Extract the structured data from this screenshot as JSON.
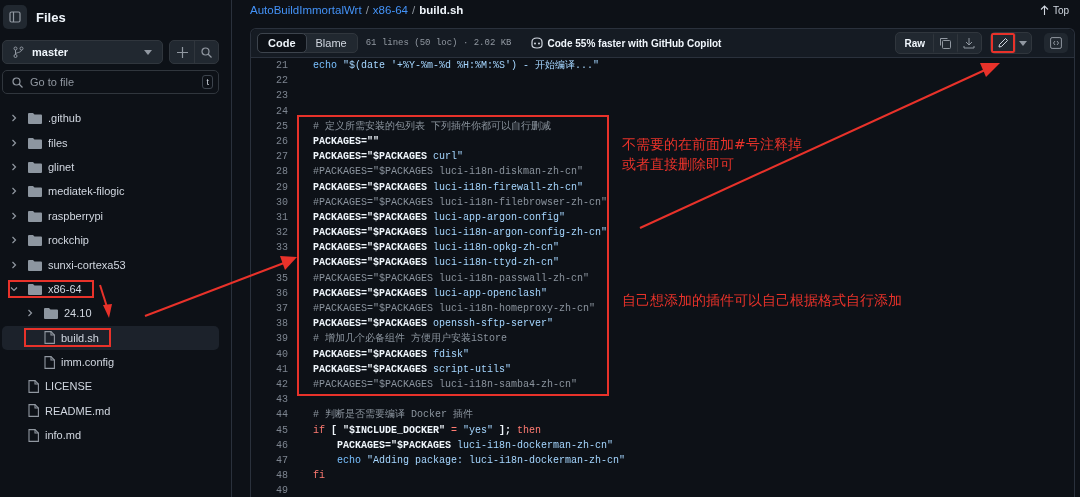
{
  "sidebar": {
    "title": "Files",
    "branch": "master",
    "search": {
      "placeholder": "Go to file",
      "shortcut": "t"
    },
    "tree": [
      {
        "name": ".github",
        "kind": "folder",
        "expanded": false,
        "selected": false,
        "marked": false
      },
      {
        "name": "files",
        "kind": "folder",
        "expanded": false,
        "selected": false,
        "marked": false
      },
      {
        "name": "glinet",
        "kind": "folder",
        "expanded": false,
        "selected": false,
        "marked": false
      },
      {
        "name": "mediatek-filogic",
        "kind": "folder",
        "expanded": false,
        "selected": false,
        "marked": false
      },
      {
        "name": "raspberrypi",
        "kind": "folder",
        "expanded": false,
        "selected": false,
        "marked": false
      },
      {
        "name": "rockchip",
        "kind": "folder",
        "expanded": false,
        "selected": false,
        "marked": false
      },
      {
        "name": "sunxi-cortexa53",
        "kind": "folder",
        "expanded": false,
        "selected": false,
        "marked": false
      },
      {
        "name": "x86-64",
        "kind": "folder",
        "expanded": true,
        "selected": false,
        "marked": true,
        "children": [
          {
            "name": "24.10",
            "kind": "folder",
            "expanded": false,
            "selected": false,
            "marked": false
          },
          {
            "name": "build.sh",
            "kind": "file",
            "selected": true,
            "marked": true
          },
          {
            "name": "imm.config",
            "kind": "file",
            "selected": false,
            "marked": false
          }
        ]
      },
      {
        "name": "LICENSE",
        "kind": "file",
        "selected": false,
        "marked": false
      },
      {
        "name": "README.md",
        "kind": "file",
        "selected": false,
        "marked": false
      },
      {
        "name": "info.md",
        "kind": "file",
        "selected": false,
        "marked": false
      }
    ]
  },
  "breadcrumb": [
    "AutoBuildImmortalWrt",
    "x86-64",
    "build.sh"
  ],
  "breadcrumb_separator": "/",
  "top_link": "Top",
  "toolbar": {
    "tabs": [
      {
        "label": "Code",
        "selected": true
      },
      {
        "label": "Blame",
        "selected": false
      }
    ],
    "file_info": "61 lines (50 loc) · 2.02 KB",
    "copilot": "Code 55% faster with GitHub Copilot",
    "raw": "Raw",
    "edit_marked": true
  },
  "code_blocks": [
    {
      "marked": false,
      "lines": [
        {
          "num": "21",
          "parts": [
            {
              "t": "echo",
              "kind": "kw"
            },
            {
              "t": " \"$(date '+%Y-%m-%d %H:%M:%S') - 开始编译...\"",
              "kind": "str"
            }
          ]
        },
        {
          "num": "22"
        },
        {
          "num": "23"
        },
        {
          "num": "24"
        }
      ]
    },
    {
      "marked": true,
      "lines": [
        {
          "num": "25",
          "parts": [
            {
              "t": "# 定义所需安装的包列表 下列插件你都可以自行删减",
              "kind": "cmt"
            }
          ]
        },
        {
          "num": "26",
          "parts": [
            {
              "t": "PACKAGES=\"\"",
              "kind": "text"
            }
          ]
        },
        {
          "num": "27",
          "parts": [
            {
              "t": "PACKAGES=\"$PACKAGES",
              "kind": "text"
            },
            {
              "t": " curl\"",
              "kind": "str"
            }
          ]
        },
        {
          "num": "28",
          "parts": [
            {
              "t": "#PACKAGES=\"$PACKAGES luci-i18n-diskman-zh-cn\"",
              "kind": "cmt"
            }
          ]
        },
        {
          "num": "29",
          "parts": [
            {
              "t": "PACKAGES=\"$PACKAGES",
              "kind": "text"
            },
            {
              "t": " luci-i18n-firewall-zh-cn\"",
              "kind": "str"
            }
          ]
        },
        {
          "num": "30",
          "parts": [
            {
              "t": "#PACKAGES=\"$PACKAGES luci-i18n-filebrowser-zh-cn\"",
              "kind": "cmt"
            }
          ]
        },
        {
          "num": "31",
          "parts": [
            {
              "t": "PACKAGES=\"$PACKAGES",
              "kind": "text"
            },
            {
              "t": " luci-app-argon-config\"",
              "kind": "str"
            }
          ]
        },
        {
          "num": "32",
          "parts": [
            {
              "t": "PACKAGES=\"$PACKAGES",
              "kind": "text"
            },
            {
              "t": " luci-i18n-argon-config-zh-cn\"",
              "kind": "str"
            }
          ]
        },
        {
          "num": "33",
          "parts": [
            {
              "t": "PACKAGES=\"$PACKAGES",
              "kind": "text"
            },
            {
              "t": " luci-i18n-opkg-zh-cn\"",
              "kind": "str"
            }
          ]
        },
        {
          "parts": [
            {
              "t": "PACKAGES=\"$PACKAGES",
              "kind": "text"
            },
            {
              "t": " luci-i18n-ttyd-zh-cn\"",
              "kind": "str"
            }
          ]
        },
        {
          "num": "35",
          "parts": [
            {
              "t": "#PACKAGES=\"$PACKAGES luci-i18n-passwall-zh-cn\"",
              "kind": "cmt"
            }
          ]
        },
        {
          "num": "36",
          "parts": [
            {
              "t": "PACKAGES=\"$PACKAGES",
              "kind": "text"
            },
            {
              "t": " luci-app-openclash\"",
              "kind": "str"
            }
          ]
        },
        {
          "num": "37",
          "parts": [
            {
              "t": "#PACKAGES=\"$PACKAGES luci-i18n-homeproxy-zh-cn\"",
              "kind": "cmt"
            }
          ]
        },
        {
          "num": "38",
          "parts": [
            {
              "t": "PACKAGES=\"$PACKAGES",
              "kind": "text"
            },
            {
              "t": " openssh-sftp-server\"",
              "kind": "str"
            }
          ]
        },
        {
          "num": "39",
          "parts": [
            {
              "t": "# 增加几个必备组件 方便用户安装iStore",
              "kind": "cmt"
            }
          ]
        },
        {
          "num": "40",
          "parts": [
            {
              "t": "PACKAGES=\"$PACKAGES",
              "kind": "text"
            },
            {
              "t": " fdisk\"",
              "kind": "str"
            }
          ]
        },
        {
          "num": "41",
          "parts": [
            {
              "t": "PACKAGES=\"$PACKAGES",
              "kind": "text"
            },
            {
              "t": " script-utils\"",
              "kind": "str"
            }
          ]
        },
        {
          "num": "42",
          "parts": [
            {
              "t": "#PACKAGES=\"$PACKAGES luci-i18n-samba4-zh-cn\"",
              "kind": "cmt"
            }
          ]
        }
      ]
    },
    {
      "marked": false,
      "lines": [
        {
          "num": "43"
        },
        {
          "num": "44",
          "parts": [
            {
              "t": "# 判断是否需要编译 Docker 插件",
              "kind": "cmt"
            }
          ]
        },
        {
          "num": "45",
          "parts": [
            {
              "t": "if",
              "kind": "red"
            },
            {
              "t": " [ \"$INCLUDE_DOCKER\" ",
              "kind": "text"
            },
            {
              "t": "=",
              "kind": "red"
            },
            {
              "t": " \"yes\"",
              "kind": "str"
            },
            {
              "t": " ]; ",
              "kind": "text"
            },
            {
              "t": "then",
              "kind": "red"
            }
          ]
        },
        {
          "num": "46",
          "parts": [
            {
              "t": "    PACKAGES=\"$PACKAGES",
              "kind": "text"
            },
            {
              "t": " luci-i18n-dockerman-zh-cn\"",
              "kind": "str"
            }
          ]
        },
        {
          "num": "47",
          "parts": [
            {
              "t": "    echo",
              "kind": "kw"
            },
            {
              "t": " \"Adding package: luci-i18n-dockerman-zh-cn\"",
              "kind": "str"
            }
          ]
        },
        {
          "num": "48",
          "parts": [
            {
              "t": "fi",
              "kind": "red"
            }
          ]
        },
        {
          "num": "49"
        }
      ]
    }
  ],
  "annotations": [
    {
      "lines": [
        "不需要的在前面加#号注释掉",
        "或者直接删除即可"
      ]
    },
    {
      "lines": [
        "自己想添加的插件可以自己根据格式自行添加"
      ]
    }
  ]
}
